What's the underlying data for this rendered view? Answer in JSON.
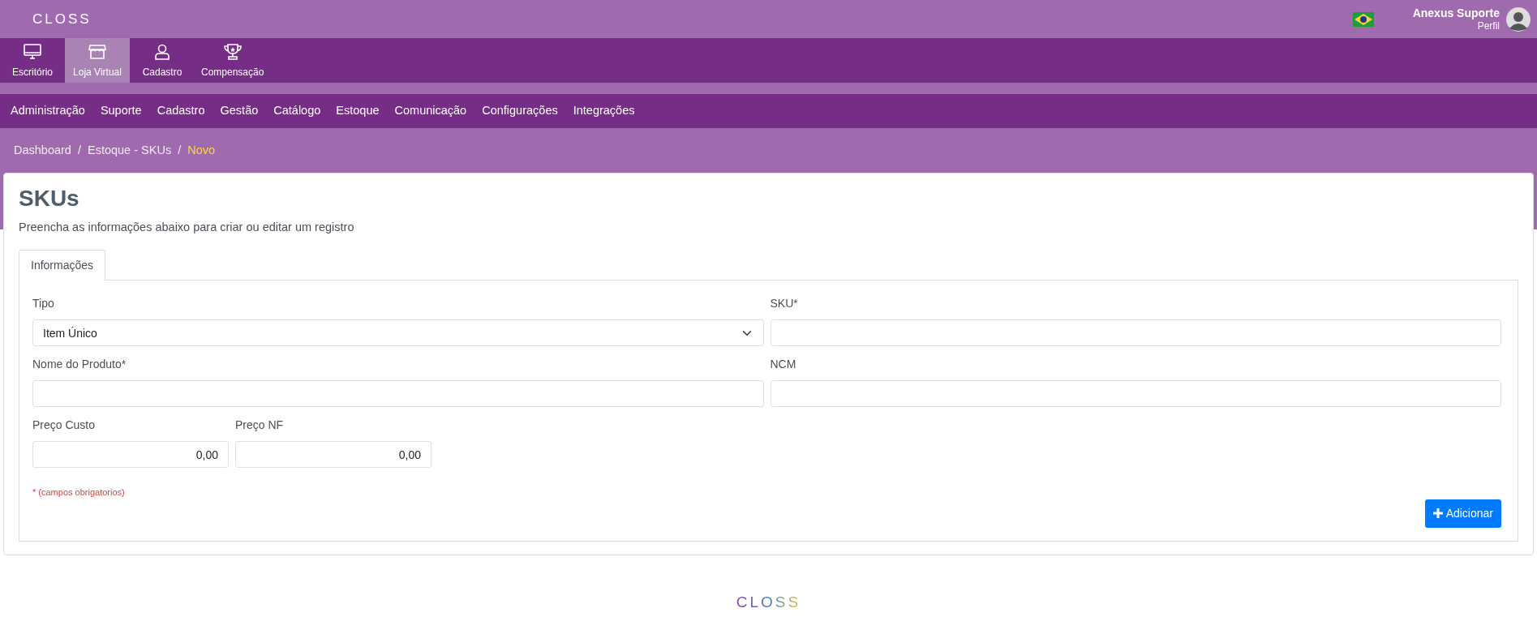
{
  "header": {
    "logo": "CLOSS",
    "user_name": "Anexus Suporte",
    "user_link": "Perfil"
  },
  "modules": [
    {
      "label": "Escritório",
      "kind": "monitor",
      "selected": false
    },
    {
      "label": "Loja Virtual",
      "kind": "store",
      "selected": true
    },
    {
      "label": "Cadastro",
      "kind": "person",
      "selected": false
    },
    {
      "label": "Compensação",
      "kind": "trophy",
      "selected": false
    }
  ],
  "menu": [
    "Administração",
    "Suporte",
    "Cadastro",
    "Gestão",
    "Catálogo",
    "Estoque",
    "Comunicação",
    "Configurações",
    "Integrações"
  ],
  "breadcrumb": [
    {
      "label": "Dashboard",
      "selected": false
    },
    {
      "separator": "/",
      "label": "Estoque - SKUs",
      "selected": false
    },
    {
      "separator": "/",
      "label": "Novo",
      "selected": true
    }
  ],
  "page": {
    "title": "SKUs",
    "subtitle": "Preencha as informações abaixo para criar ou editar um registro"
  },
  "tabs": [
    {
      "label": "Informações",
      "selected": true
    }
  ],
  "form": {
    "tipo": {
      "label": "Tipo",
      "value": "Item Único"
    },
    "sku": {
      "label": "SKU*"
    },
    "nome": {
      "label": "Nome do Produto*"
    },
    "ncm": {
      "label": "NCM"
    },
    "preco_custo": {
      "label": "Preço Custo",
      "value": "0,00"
    },
    "preco_nf": {
      "label": "Preço NF",
      "value": "0,00"
    },
    "required_note": "* (campos obrigatorios)",
    "submit": "Adicionar"
  },
  "footer": {
    "logo": "CLOSS"
  }
}
